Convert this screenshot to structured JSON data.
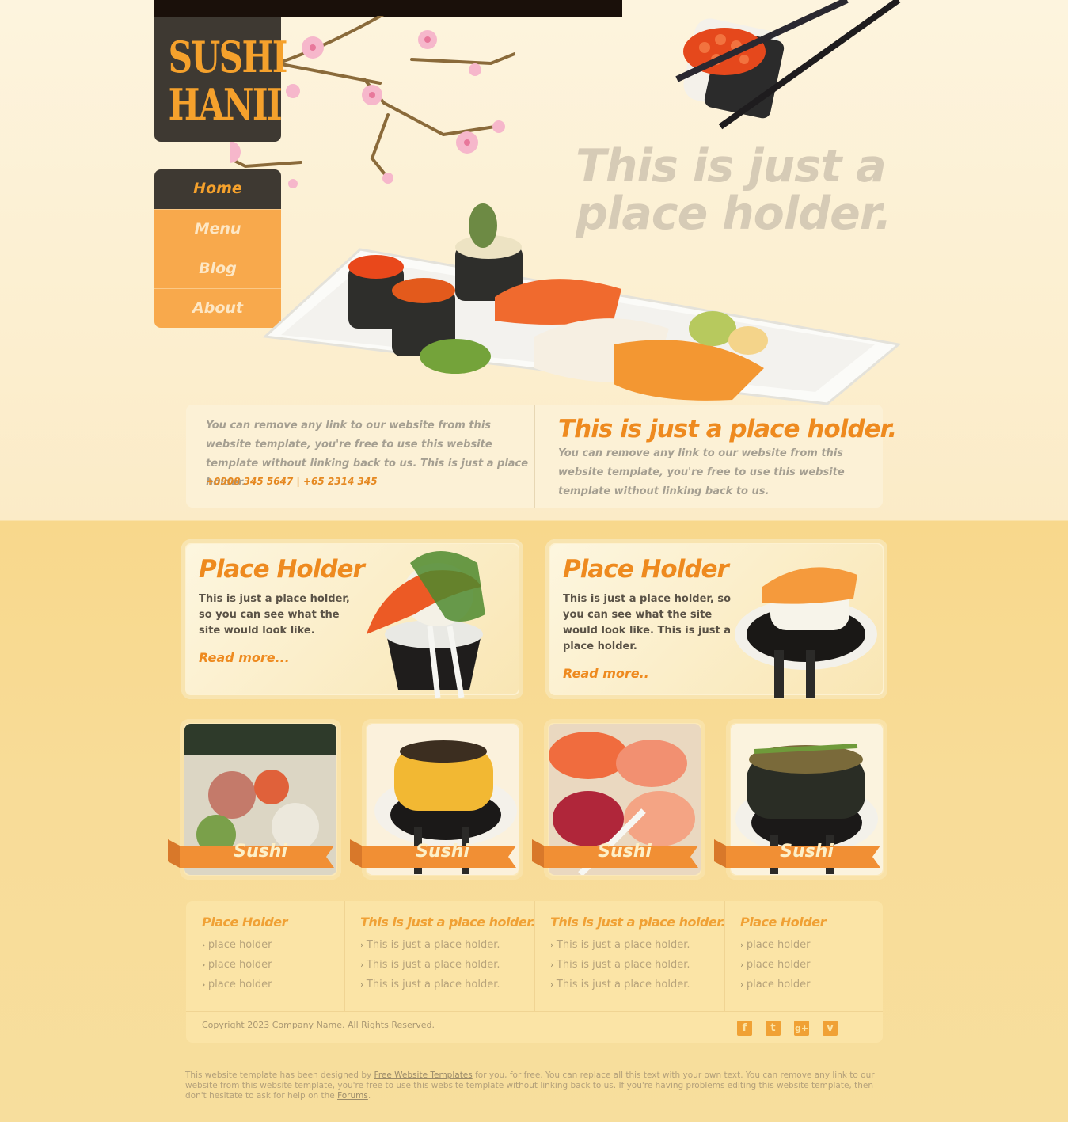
{
  "logo": {
    "line1": "SUSHI",
    "line2": "HANII"
  },
  "nav": [
    {
      "label": "Home"
    },
    {
      "label": "Menu"
    },
    {
      "label": "Blog"
    },
    {
      "label": "About"
    }
  ],
  "hero": {
    "title_line1": "This is just a",
    "title_line2": "place holder."
  },
  "info": {
    "left_text": "You can remove any link to our website from this website template, you're free to use this website template without linking back to us. This is just a place holder.",
    "phone": "+0908 345 5647 | +65 2314 345",
    "right_title": "This is just a place holder.",
    "right_text": "You can remove any link to our website from this website template, you're free to use this website template without linking back to us."
  },
  "features": [
    {
      "title": "Place Holder",
      "text": "This is just a place holder, so you can see what the site would look like.",
      "more": "Read more..."
    },
    {
      "title": "Place Holder",
      "text": "This is just a place holder, so you can see what the site would look like. This is just a place holder.",
      "more": "Read more.."
    }
  ],
  "thumbs": [
    {
      "label": "Sushi"
    },
    {
      "label": "Sushi"
    },
    {
      "label": "Sushi"
    },
    {
      "label": "Sushi"
    }
  ],
  "footer": {
    "columns": [
      {
        "title": "Place Holder",
        "links": [
          "place holder",
          "place holder",
          "place holder"
        ]
      },
      {
        "title": "This is just a place holder.",
        "links": [
          "This is just a place holder.",
          "This is just a place holder.",
          "This is just a place holder."
        ]
      },
      {
        "title": "This is just a place holder.",
        "links": [
          "This is just a place holder.",
          "This is just a place holder.",
          "This is just a place holder."
        ]
      },
      {
        "title": "Place Holder",
        "links": [
          "place holder",
          "place holder",
          "place holder"
        ]
      }
    ],
    "copyright": "Copyright 2023 Company Name. All Rights Reserved.",
    "social": [
      "facebook-icon",
      "twitter-icon",
      "google-plus-icon",
      "vimeo-icon"
    ]
  },
  "credit": {
    "part1": "This website template has been designed by",
    "link1": "Free Website Templates",
    "part2": "for you, for free. You can replace all this text with your own text. You can remove any link to our website from this website template, you're free to use this website template without linking back to us. If you're having problems editing this website template, then don't hesitate to ask for help on the",
    "link2": "Forums",
    "part3": "."
  },
  "colors": {
    "accent": "#ee8a1f",
    "dark": "#3e3932",
    "nav_orange": "#f8a94c"
  }
}
